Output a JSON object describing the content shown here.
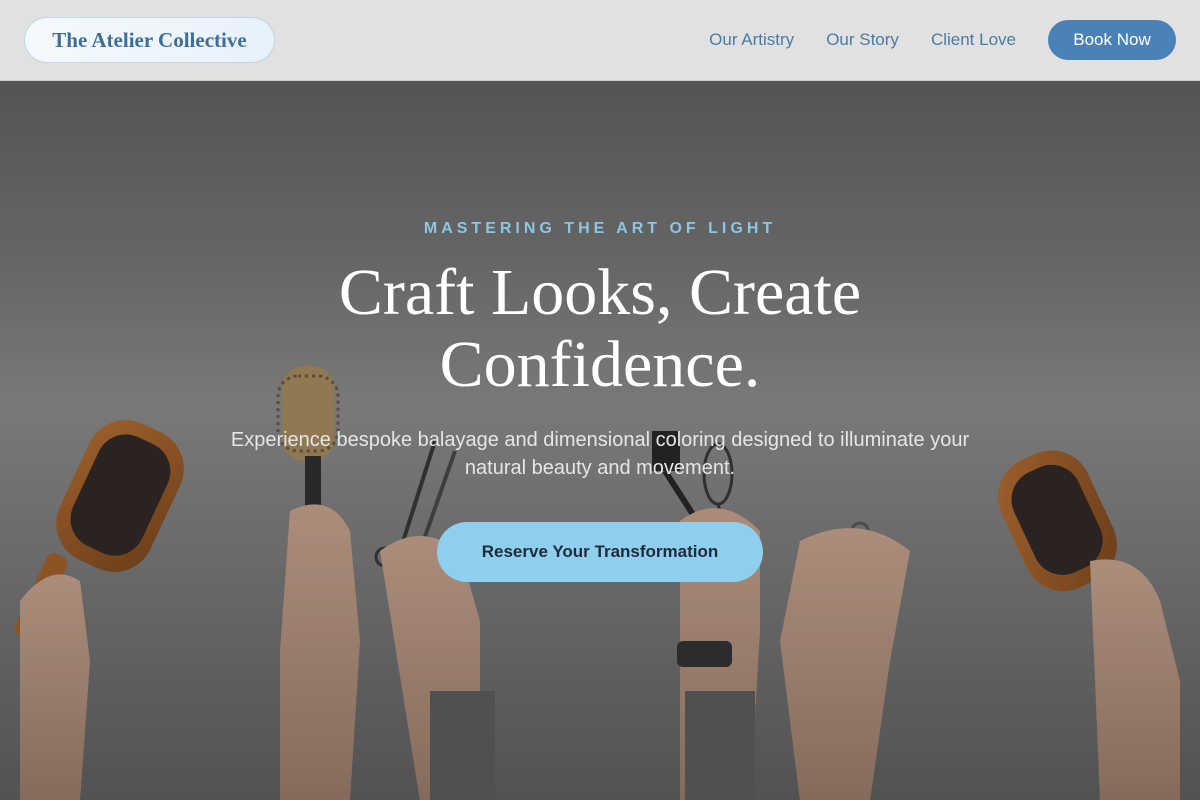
{
  "header": {
    "logo": "The Atelier Collective",
    "nav": [
      "Our Artistry",
      "Our Story",
      "Client Love"
    ],
    "cta": "Book Now"
  },
  "hero": {
    "eyebrow": "MASTERING THE ART OF LIGHT",
    "headline": "Craft Looks, Create Confidence.",
    "subtext": "Experience bespoke balayage and dimensional coloring designed to illuminate your natural beauty and movement.",
    "cta": "Reserve Your Transformation",
    "image_description": "hands raising hairbrushes, scissors and a whisk against a grey wall"
  },
  "colors": {
    "accent": "#8fcfee",
    "brand_blue": "#4a82b8",
    "header_bg": "#e1e1e1"
  }
}
